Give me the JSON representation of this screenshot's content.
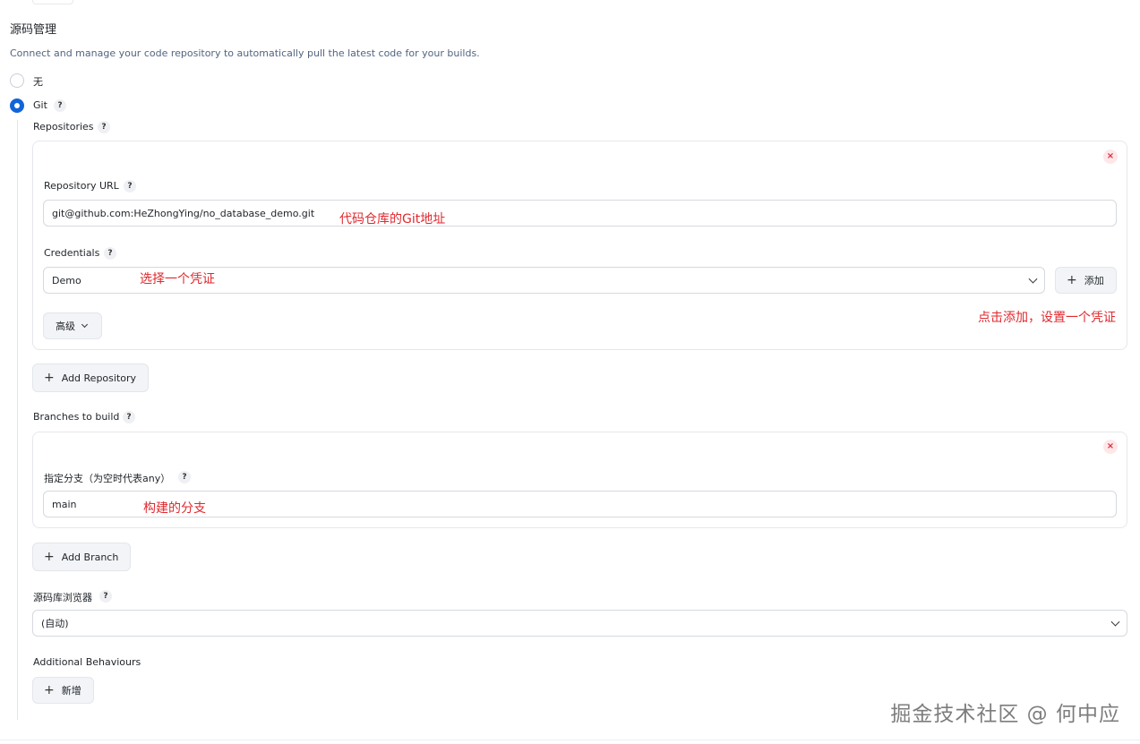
{
  "section": {
    "title": "源码管理",
    "description": "Connect and manage your code repository to automatically pull the latest code for your builds."
  },
  "scm_options": [
    {
      "label": "无",
      "selected": false
    },
    {
      "label": "Git",
      "selected": true
    }
  ],
  "help_label": "?",
  "repositories": {
    "label": "Repositories",
    "remove_label": "×",
    "url_label": "Repository URL",
    "url_value": "git@github.com:HeZhongYing/no_database_demo.git",
    "credentials_label": "Credentials",
    "credentials_value": "Demo",
    "add_credential_label": "添加",
    "advanced_label": "高级",
    "add_repository_label": "Add Repository"
  },
  "branches": {
    "label": "Branches to build",
    "remove_label": "×",
    "specifier_label": "指定分支（为空时代表any）",
    "specifier_value": "main",
    "add_branch_label": "Add Branch"
  },
  "browser": {
    "label": "源码库浏览器",
    "value": "(自动)"
  },
  "additional": {
    "label": "Additional Behaviours",
    "add_label": "新增"
  },
  "annotations": {
    "repo_url_note": "代码仓库的Git地址",
    "credentials_note": "选择一个凭证",
    "add_note": "点击添加，设置一个凭证",
    "branch_note": "构建的分支"
  },
  "watermark": "掘金技术社区 @ 何中应",
  "colors": {
    "accent": "#1264d9",
    "annotation": "#e0282e",
    "description": "#516580",
    "remove": "#d62d3b"
  }
}
